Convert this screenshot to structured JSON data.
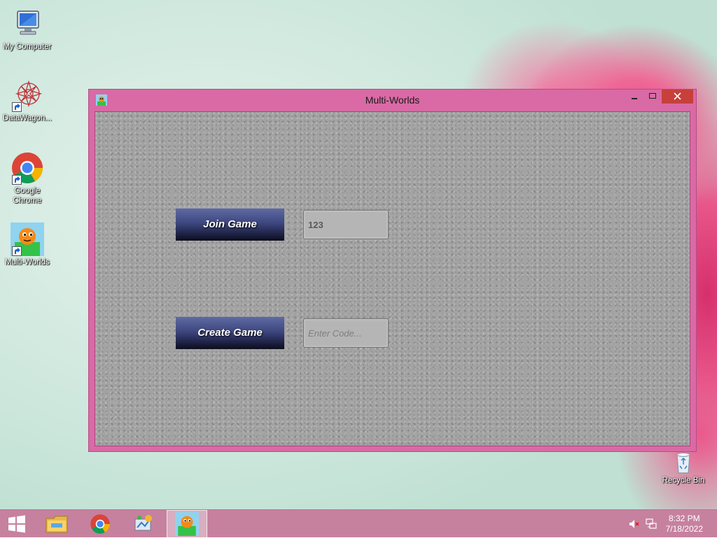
{
  "desktop": {
    "icons": [
      {
        "label": "My Computer"
      },
      {
        "label": "DataWagon..."
      },
      {
        "label": "Google Chrome"
      },
      {
        "label": "Multi-Worlds"
      },
      {
        "label": "Recycle Bin"
      }
    ]
  },
  "window": {
    "title": "Multi-Worlds",
    "minimize_glyph": "–",
    "maximize_glyph": "☐",
    "close_glyph": "✕"
  },
  "app": {
    "join_button_label": "Join Game",
    "join_code_value": "123",
    "create_button_label": "Create Game",
    "create_code_placeholder": "Enter Code..."
  },
  "taskbar": {
    "items": [
      {
        "icon": "windows-start-icon"
      },
      {
        "icon": "file-explorer-icon"
      },
      {
        "icon": "chrome-icon"
      },
      {
        "icon": "control-panel-icon"
      },
      {
        "icon": "multi-worlds-icon",
        "active": true
      }
    ],
    "clock": {
      "time": "8:32 PM",
      "date": "7/18/2022"
    }
  }
}
